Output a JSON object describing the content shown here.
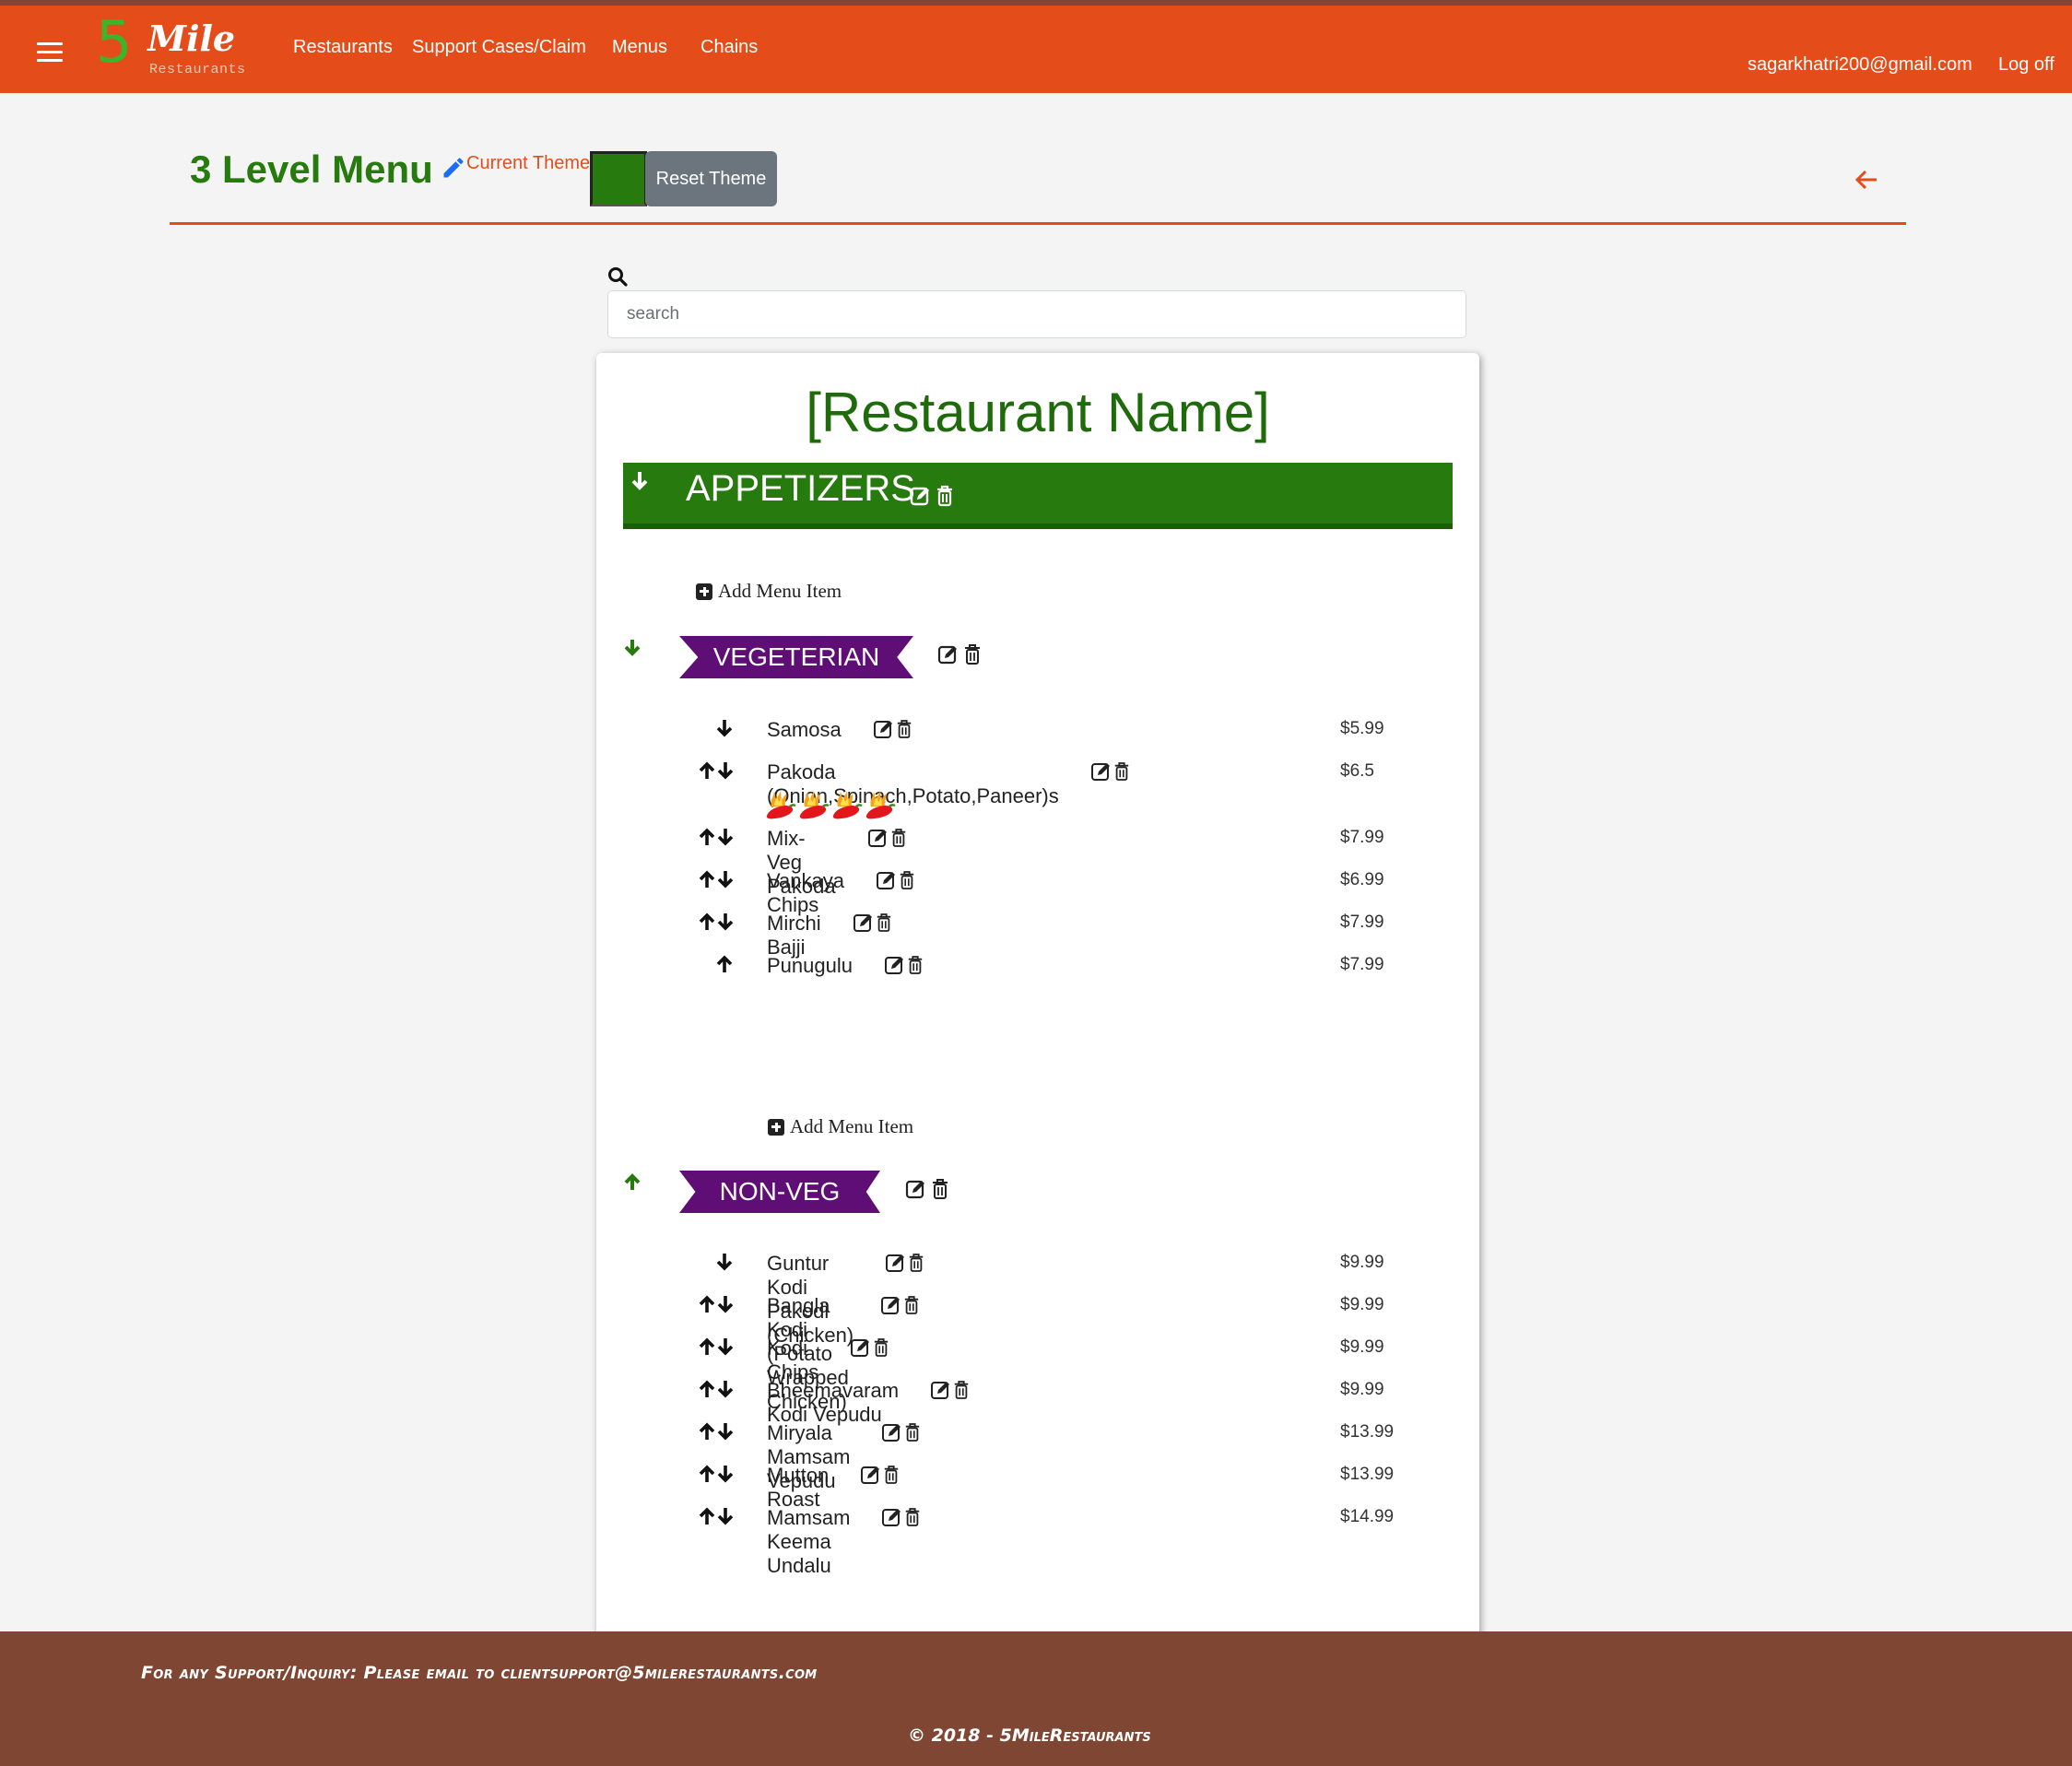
{
  "nav": {
    "logo_number": "5",
    "logo_word": "Mile",
    "logo_sub": "Restaurants",
    "links": [
      "Restaurants",
      "Support Cases/Claim",
      "Menus",
      "Chains"
    ],
    "user_email": "sagarkhatri200@gmail.com",
    "logout_label": "Log off"
  },
  "header": {
    "title": "3 Level Menu",
    "theme_label": "Current Theme",
    "theme_color": "#267a0e",
    "reset_label": "Reset Theme"
  },
  "search": {
    "placeholder": "search",
    "value": ""
  },
  "menu": {
    "restaurant_name": "[Restaurant Name]",
    "section": {
      "title": "APPETIZERS",
      "add_item_label": "Add Menu Item"
    },
    "categories": [
      {
        "name": "VEGETERIAN",
        "toggle": "down",
        "items": [
          {
            "name": "Samosa",
            "price": "$5.99",
            "move": "down",
            "spice_level": 0
          },
          {
            "name": "Pakoda (Onion,Spinach,Potato,Paneer)s",
            "price": "$6.5",
            "move": "both",
            "spice_level": 4
          },
          {
            "name": "Mix-Veg Pakoda",
            "price": "$7.99",
            "move": "both",
            "spice_level": 0
          },
          {
            "name": "Vankaya Chips",
            "price": "$6.99",
            "move": "both",
            "spice_level": 0
          },
          {
            "name": "Mirchi Bajji",
            "price": "$7.99",
            "move": "both",
            "spice_level": 0
          },
          {
            "name": "Punugulu",
            "price": "$7.99",
            "move": "up",
            "spice_level": 0
          }
        ],
        "add_item_label": "Add Menu Item"
      },
      {
        "name": "NON-VEG",
        "toggle": "up",
        "items": [
          {
            "name": "Guntur Kodi Pakodi (Chicken)",
            "price": "$9.99",
            "move": "down",
            "spice_level": 0
          },
          {
            "name": "Bangla Kodi (Potato Wrapped Chicken)",
            "price": "$9.99",
            "move": "both",
            "spice_level": 0
          },
          {
            "name": "Kodi Chips",
            "price": "$9.99",
            "move": "both",
            "spice_level": 0
          },
          {
            "name": "Bheemavaram Kodi Vepudu",
            "price": "$9.99",
            "move": "both",
            "spice_level": 0
          },
          {
            "name": "Miryala Mamsam Vepudu",
            "price": "$13.99",
            "move": "both",
            "spice_level": 0
          },
          {
            "name": "Mutton Roast",
            "price": "$13.99",
            "move": "both",
            "spice_level": 0
          },
          {
            "name": "Mamsam Keema Undalu",
            "price": "$14.99",
            "move": "both",
            "spice_level": 0
          }
        ]
      }
    ]
  },
  "footer": {
    "support_text": "For any Support/Inquiry: Please email to clientsupport@5milerestaurants.com",
    "copyright": "© 2018 - 5MileRestaurants"
  },
  "colors": {
    "nav_bg": "#e44d1a",
    "footer_bg": "#7f4733",
    "section_bg": "#267a0e",
    "ribbon_bg": "#5e0e75",
    "accent": "#e44d1a"
  }
}
